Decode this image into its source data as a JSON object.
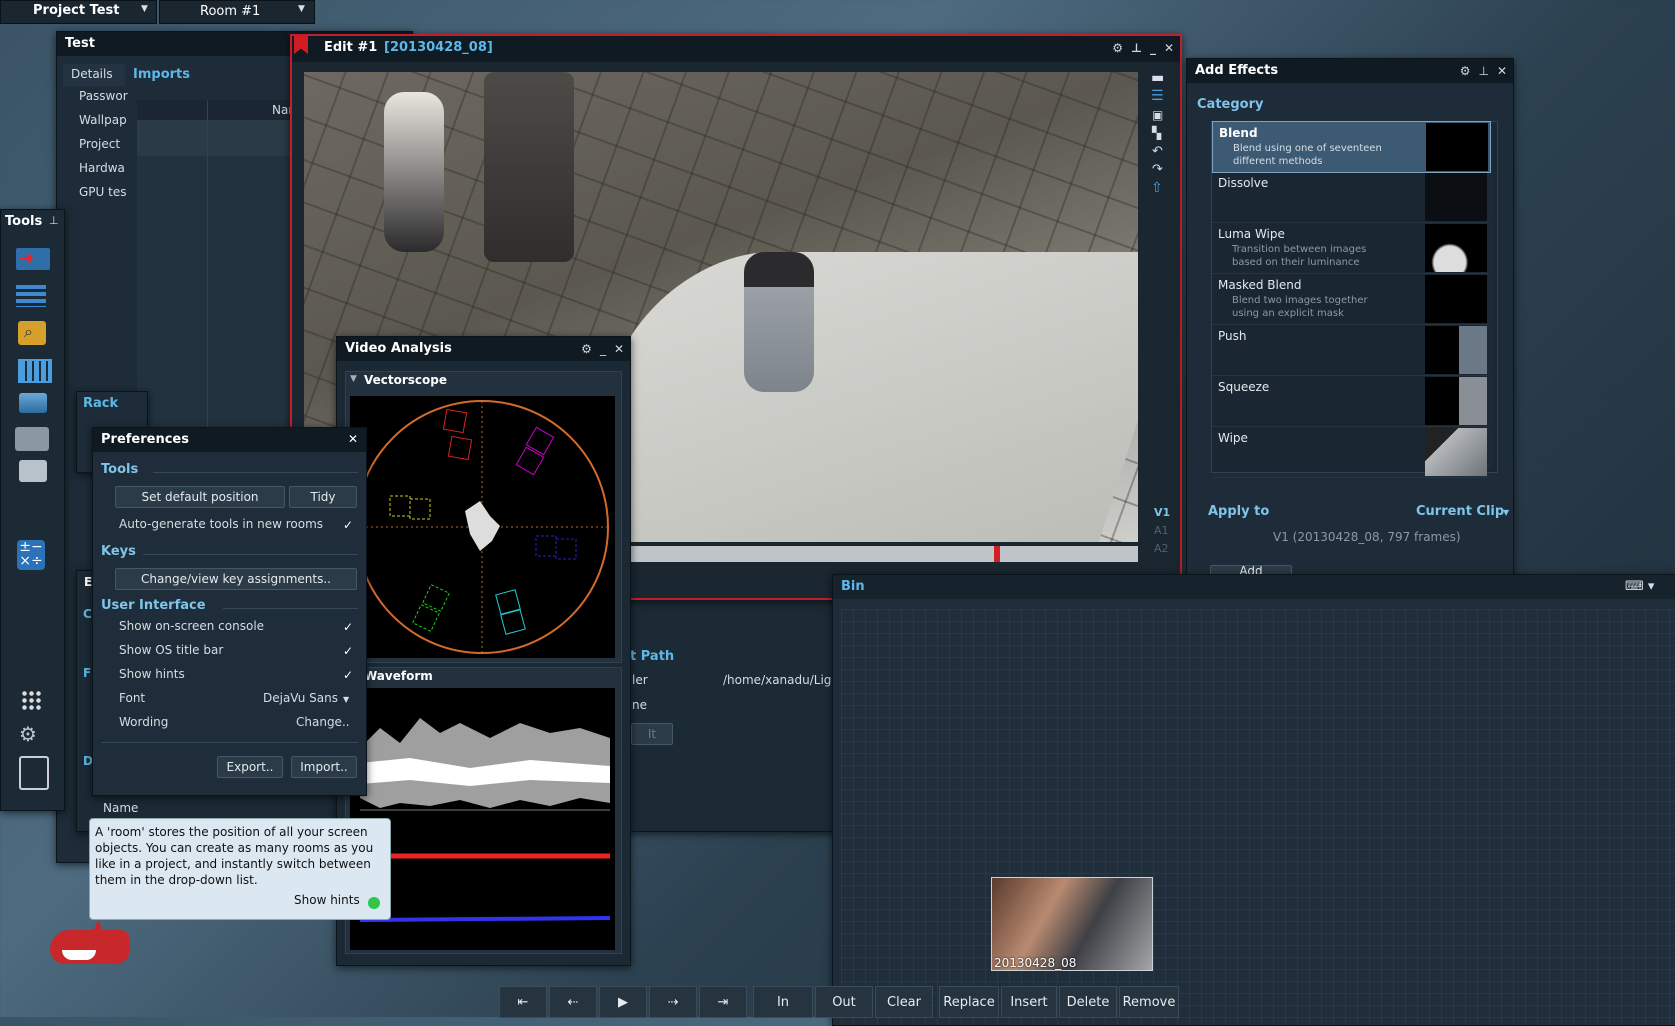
{
  "topbar": {
    "project": "Project Test",
    "room": "Room #1"
  },
  "test_panel": {
    "title": "Test",
    "tabs": [
      "Details",
      "Imports"
    ],
    "column": "Name",
    "items": [
      "Passwor",
      "Wallpap",
      "Project",
      "Hardwa",
      "GPU tes"
    ]
  },
  "tools": {
    "title": "Tools"
  },
  "rack": {
    "title": "Rack"
  },
  "edit": {
    "title": "Edit #1",
    "clip": "[20130428_08]",
    "tracks": [
      "V1",
      "A1",
      "A2"
    ]
  },
  "analysis": {
    "title": "Video Analysis",
    "vectorscope": "Vectorscope",
    "waveform": "Waveform"
  },
  "preferences": {
    "title": "Preferences",
    "tools_header": "Tools",
    "set_default": "Set default position",
    "tidy": "Tidy",
    "auto_generate": "Auto-generate tools in new rooms",
    "keys_header": "Keys",
    "change_keys": "Change/view key assignments..",
    "ui_header": "User Interface",
    "console": "Show on-screen console",
    "os_title": "Show OS title bar",
    "hints": "Show hints",
    "font_label": "Font",
    "font_value": "DejaVu Sans",
    "wording_label": "Wording",
    "wording_value": "Change..",
    "export": "Export..",
    "import": "Import..",
    "check": "✓"
  },
  "behind": {
    "name": "Name",
    "path_header": "t Path",
    "row1_label": "ler",
    "row1_value": "/home/xanadu/Lig",
    "row2_label": "ne",
    "btn": "It",
    "e": "E",
    "c": "C",
    "f": "F",
    "d": "D"
  },
  "hint": {
    "text": "A 'room' stores the position of all your screen objects.  You can create as many rooms as you like in a project, and instantly switch between them in the drop-down list.",
    "toggle": "Show hints"
  },
  "effects": {
    "title": "Add Effects",
    "category": "Category",
    "items": [
      {
        "name": "Blend",
        "desc": "Blend using one of seventeen\ndifferent methods"
      },
      {
        "name": "Dissolve",
        "desc": ""
      },
      {
        "name": "Luma Wipe",
        "desc": "Transition between images\nbased on their luminance"
      },
      {
        "name": "Masked Blend",
        "desc": "Blend two images together\nusing an explicit mask"
      },
      {
        "name": "Push",
        "desc": ""
      },
      {
        "name": "Squeeze",
        "desc": ""
      },
      {
        "name": "Wipe",
        "desc": ""
      }
    ],
    "apply_to": "Apply to",
    "current_clip": "Current Clip",
    "clip_info": "V1 (20130428_08, 797 frames)",
    "add": "Add"
  },
  "bin": {
    "title": "Bin",
    "clip": "20130428_08"
  },
  "transport": {
    "buttons": [
      "In",
      "Out",
      "Clear",
      "Replace",
      "Insert",
      "Delete",
      "Remove"
    ]
  },
  "colors": {
    "accent": "#5cb8e6",
    "edit_border": "#c0202a"
  }
}
